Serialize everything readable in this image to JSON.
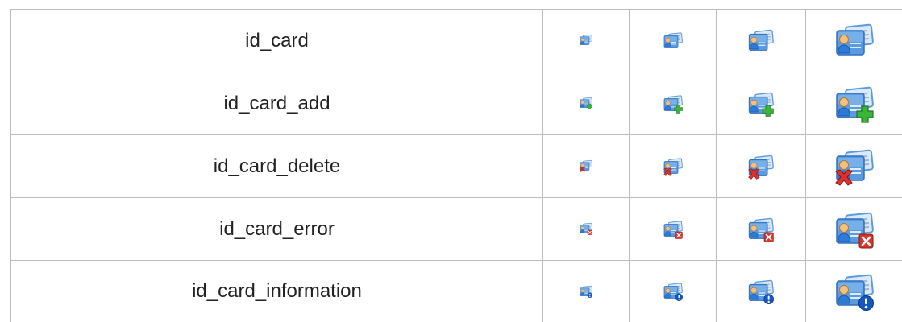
{
  "rows": [
    {
      "name": "id_card",
      "overlay": "none"
    },
    {
      "name": "id_card_add",
      "overlay": "add"
    },
    {
      "name": "id_card_delete",
      "overlay": "delete"
    },
    {
      "name": "id_card_error",
      "overlay": "error"
    },
    {
      "name": "id_card_information",
      "overlay": "information"
    }
  ],
  "icon_sizes": [
    16,
    24,
    32,
    48
  ],
  "colors": {
    "card_blue": "#5a9be0",
    "card_light": "#dce9f8",
    "add_green": "#3cb43c",
    "delete_red": "#e0302a",
    "error_red": "#d9362b",
    "info_blue": "#1556c0",
    "border": "#bdbdbd"
  }
}
